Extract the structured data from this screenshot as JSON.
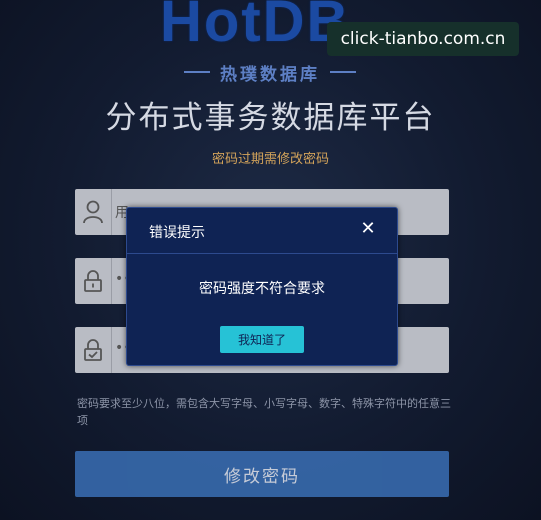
{
  "logo": {
    "text": "HotDB",
    "subtitle": "热璞数据库"
  },
  "watermark": "click-tianbo.com.cn",
  "page_title": "分布式事务数据库平台",
  "notice": "密码过期需修改密码",
  "form": {
    "username_placeholder": "用",
    "password_value": "•••",
    "confirm_value": "•••",
    "hint": "密码要求至少八位，需包含大写字母、小写字母、数字、特殊字符中的任意三项",
    "submit_label": "修改密码"
  },
  "dialog": {
    "title": "错误提示",
    "close_symbol": "✕",
    "message": "密码强度不符合要求",
    "ok_label": "我知道了"
  },
  "colors": {
    "background": "#121b30",
    "dialog_bg": "#0f2354",
    "ok_button": "#26c2d6",
    "notice": "#d3a35a",
    "submit": "#3a6fb5"
  },
  "icons": [
    "user-icon",
    "lock-icon",
    "shield-check-icon",
    "close-icon"
  ]
}
